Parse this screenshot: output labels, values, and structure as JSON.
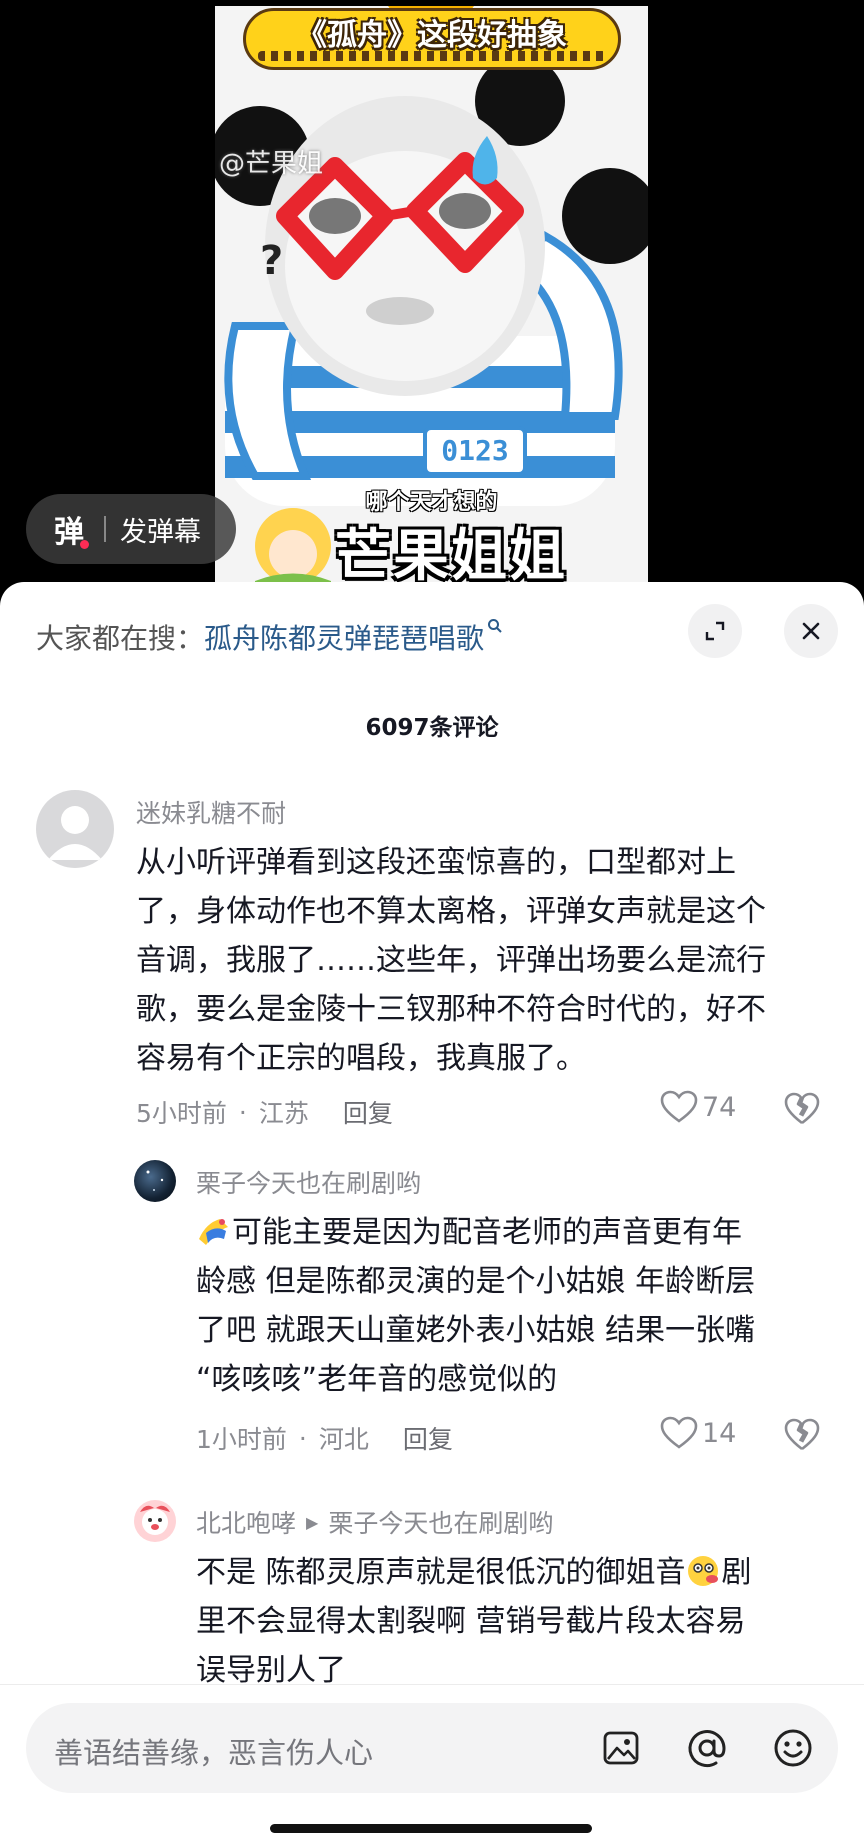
{
  "video": {
    "title_banner": "《孤舟》这段好抽象",
    "watermark": "@芒果姐",
    "subtitle_small": "哪个天才想的",
    "subtitle_big": "芒果姐姐",
    "shirt_text": "0123"
  },
  "danmaku": {
    "icon_glyph": "弹",
    "label": "发弹幕"
  },
  "sheet": {
    "search_prefix": "大家都在搜：",
    "search_query": "孤舟陈都灵弹琵琶唱歌",
    "comment_count": "6097条评论"
  },
  "comments": [
    {
      "author": "迷妹乳糖不耐",
      "text_lines": [
        "从小听评弹看到这段还蛮惊喜的，口型都对上",
        "了，身体动作也不算太离格，评弹女声就是这个",
        "音调，我服了……这些年，评弹出场要么是流行",
        "歌，要么是金陵十三钗那种不符合时代的，好不",
        "容易有个正宗的唱段，我真服了。"
      ],
      "time": "5小时前",
      "location": "江苏",
      "reply_label": "回复",
      "likes": "74"
    },
    {
      "author": "栗子今天也在刷剧哟",
      "text_lines": [
        "可能主要是因为配音老师的声音更有年",
        "龄感 但是陈都灵演的是个小姑娘 年龄断层",
        "了吧 就跟天山童姥外表小姑娘 结果一张嘴",
        "“咳咳咳”老年音的感觉似的"
      ],
      "time": "1小时前",
      "location": "河北",
      "reply_label": "回复",
      "likes": "14"
    },
    {
      "author": "北北咆哮",
      "reply_to": "栗子今天也在刷剧哟",
      "text_lines": [
        "不是 陈都灵原声就是很低沉的御姐音",
        "里不会显得太割裂啊  营销号截片段太容易",
        "误导别人了"
      ],
      "text_line1_tail": "剧"
    }
  ],
  "input": {
    "placeholder": "善语结善缘，恶言伤人心"
  },
  "icons": [
    "expand-icon",
    "close-icon",
    "search-icon",
    "heart-icon",
    "broken-heart-icon",
    "image-icon",
    "at-icon",
    "emoji-icon"
  ]
}
